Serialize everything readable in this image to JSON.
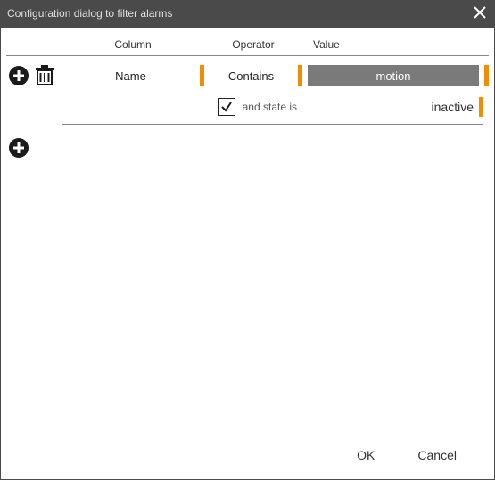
{
  "title": "Configuration dialog to filter alarms",
  "headers": {
    "column": "Column",
    "operator": "Operator",
    "value": "Value"
  },
  "filters": [
    {
      "column": "Name",
      "operator": "Contains",
      "value": "motion",
      "state": {
        "enabled": true,
        "label": "and state is",
        "value": "inactive"
      }
    }
  ],
  "footer": {
    "ok": "OK",
    "cancel": "Cancel"
  },
  "colors": {
    "accent": "#f28c00",
    "titlebar": "#4a4a4a"
  }
}
